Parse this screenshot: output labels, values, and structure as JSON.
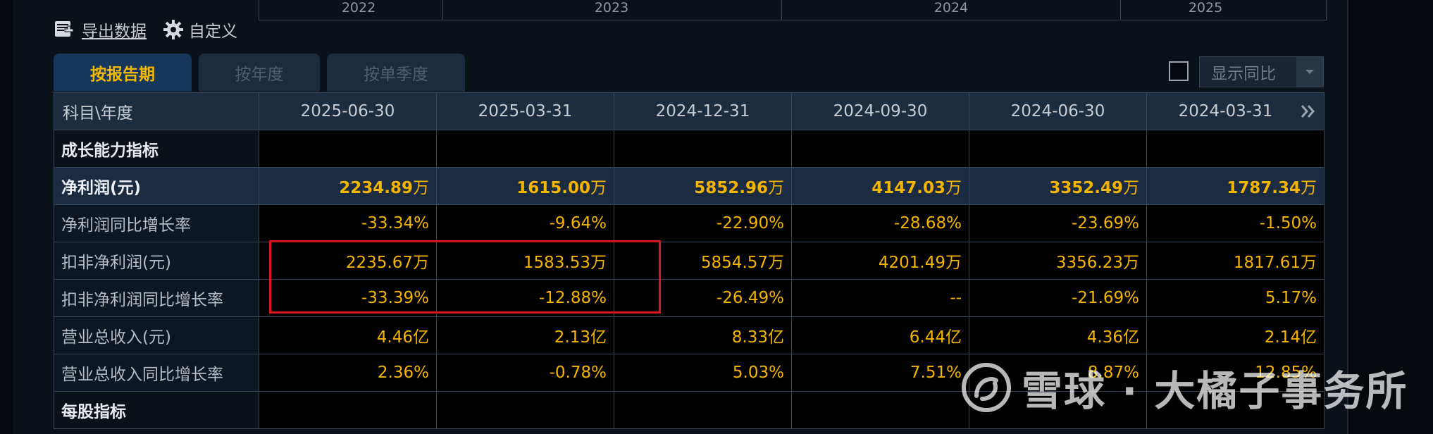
{
  "timeline": {
    "years": [
      "2022",
      "2023",
      "2024",
      "2025"
    ]
  },
  "toolbar": {
    "export_label": "导出数据",
    "custom_label": "自定义"
  },
  "tabs": [
    {
      "label": "按报告期",
      "active": true
    },
    {
      "label": "按年度",
      "active": false
    },
    {
      "label": "按单季度",
      "active": false
    }
  ],
  "yoy_toggle": {
    "label": "显示同比",
    "checked": false
  },
  "table": {
    "header_first": "科目\\年度",
    "columns": [
      "2025-06-30",
      "2025-03-31",
      "2024-12-31",
      "2024-09-30",
      "2024-06-30",
      "2024-03-31"
    ],
    "rows": [
      {
        "label": "成长能力指标",
        "type": "section",
        "values": [
          "",
          "",
          "",
          "",
          "",
          ""
        ]
      },
      {
        "label": "净利润(元)",
        "type": "net",
        "values": [
          "2234.89万",
          "1615.00万",
          "5852.96万",
          "4147.03万",
          "3352.49万",
          "1787.34万"
        ]
      },
      {
        "label": "净利润同比增长率",
        "type": "normal",
        "values": [
          "-33.34%",
          "-9.64%",
          "-22.90%",
          "-28.68%",
          "-23.69%",
          "-1.50%"
        ]
      },
      {
        "label": "扣非净利润(元)",
        "type": "normal",
        "values": [
          "2235.67万",
          "1583.53万",
          "5854.57万",
          "4201.49万",
          "3356.23万",
          "1817.61万"
        ]
      },
      {
        "label": "扣非净利润同比增长率",
        "type": "normal",
        "values": [
          "-33.39%",
          "-12.88%",
          "-26.49%",
          "--",
          "-21.69%",
          "5.17%"
        ]
      },
      {
        "label": "营业总收入(元)",
        "type": "normal",
        "values": [
          "4.46亿",
          "2.13亿",
          "8.33亿",
          "6.44亿",
          "4.36亿",
          "2.14亿"
        ]
      },
      {
        "label": "营业总收入同比增长率",
        "type": "normal",
        "values": [
          "2.36%",
          "-0.78%",
          "5.03%",
          "7.51%",
          "8.87%",
          "12.85%"
        ]
      },
      {
        "label": "每股指标",
        "type": "section",
        "values": [
          "",
          "",
          "",
          "",
          "",
          ""
        ]
      }
    ]
  },
  "watermark": {
    "text": "雪球 · 大橘子事务所"
  },
  "colors": {
    "accent": "#f5b400",
    "highlight": "#d9141a",
    "header_bg": "#1d2d40"
  }
}
